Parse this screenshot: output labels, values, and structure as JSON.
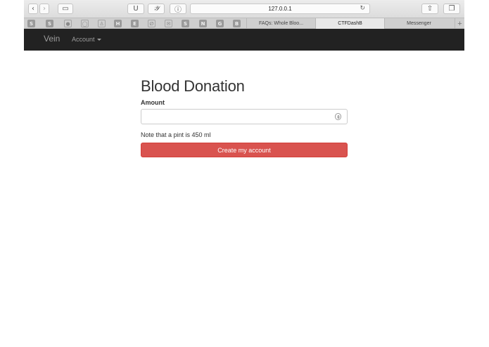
{
  "browser": {
    "url": "127.0.0.1",
    "toolbar_badges": [
      "U",
      "𝒴",
      "ⓘ"
    ],
    "favorites": [
      "S",
      "S",
      "●",
      "◯",
      "♙",
      "H",
      "E",
      "∅",
      "✉",
      "S",
      "N",
      "G",
      "B"
    ],
    "tabs": [
      {
        "label": "FAQs: Whole Bloo...",
        "active": false
      },
      {
        "label": "CTFDashB",
        "active": true
      },
      {
        "label": "Messenger",
        "active": false
      }
    ],
    "new_tab": "+"
  },
  "navbar": {
    "brand": "Vein",
    "account_label": "Account"
  },
  "page": {
    "title": "Blood Donation",
    "amount_label": "Amount",
    "amount_value": "",
    "note": "Note that a pint is 450 ml",
    "submit_label": "Create my account"
  },
  "colors": {
    "navbar_bg": "#222222",
    "button_bg": "#d9534f"
  }
}
